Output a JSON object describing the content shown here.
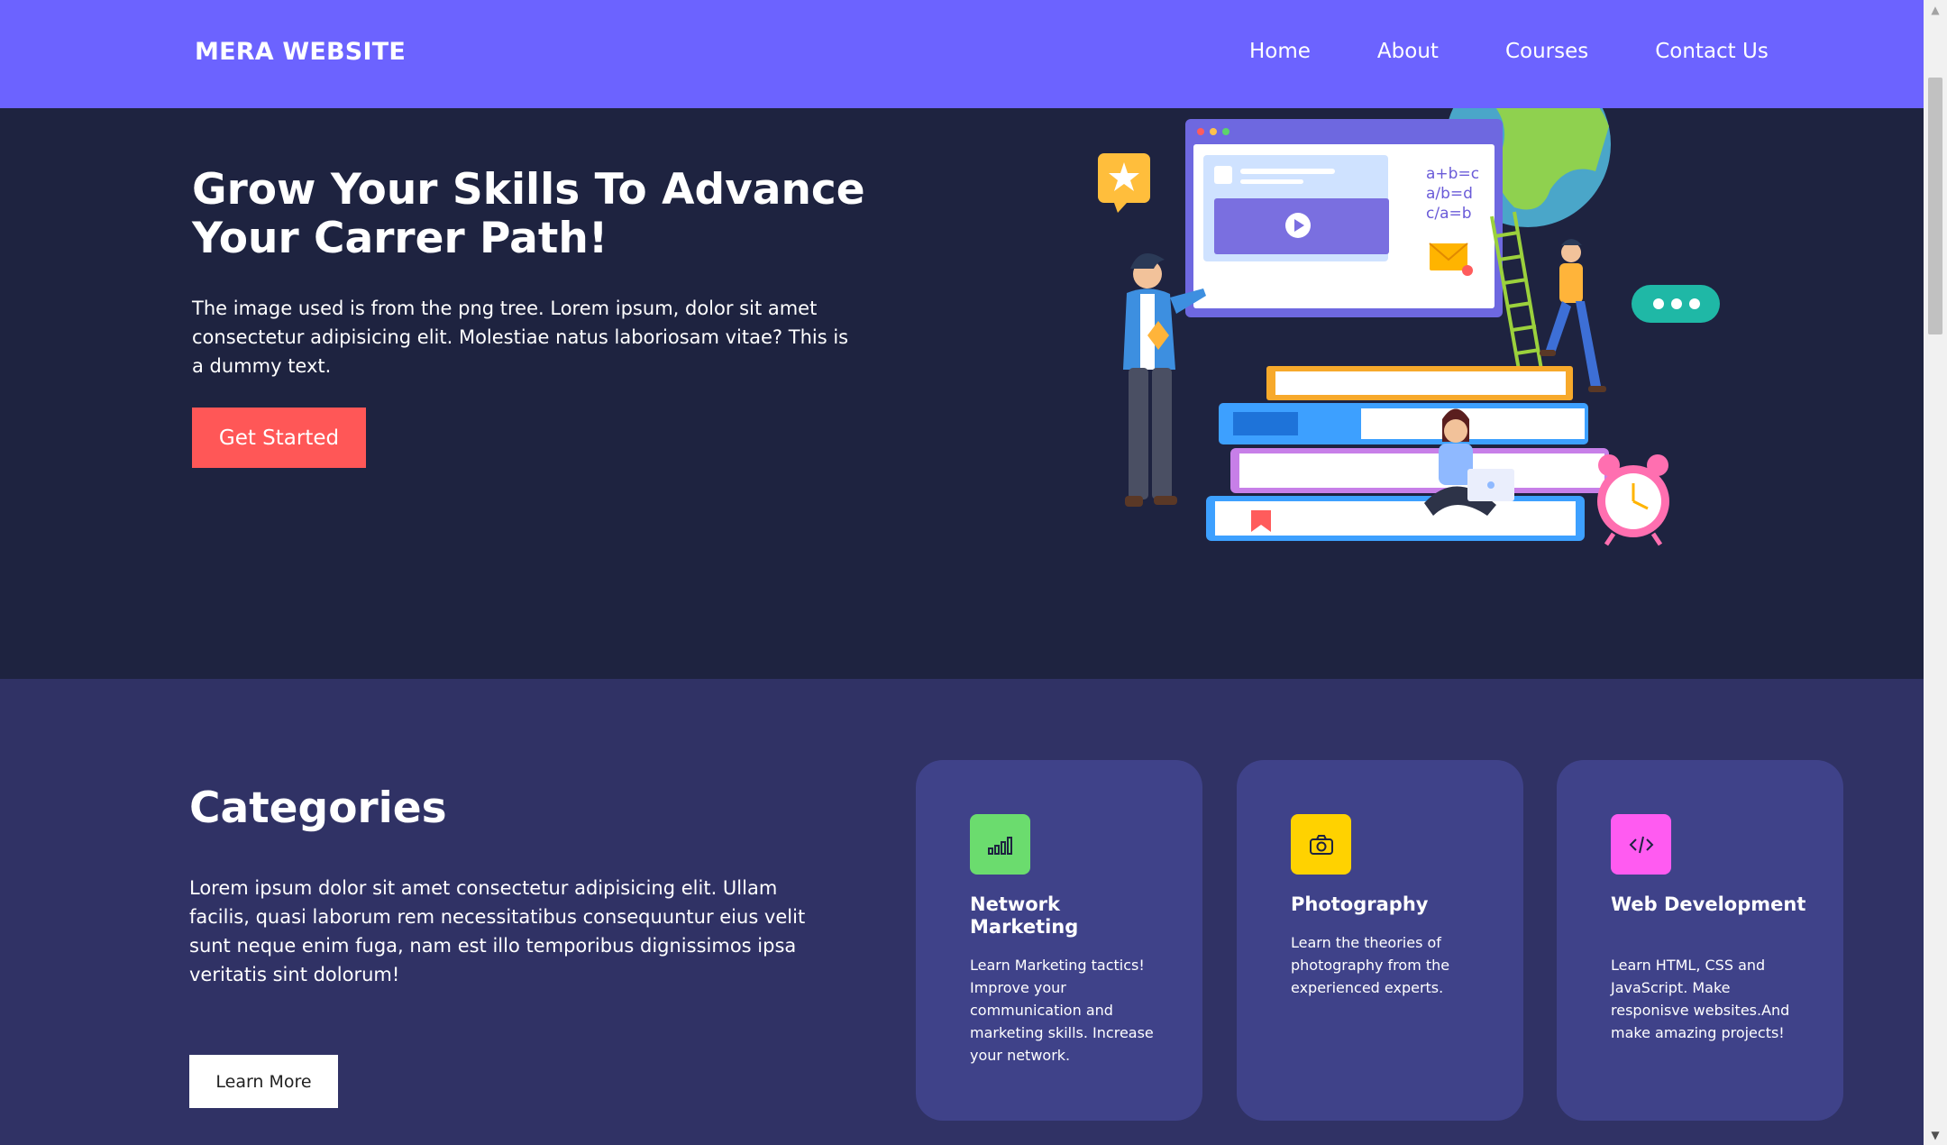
{
  "nav": {
    "brand": "MERA WEBSITE",
    "links": [
      "Home",
      "About",
      "Courses",
      "Contact Us"
    ]
  },
  "hero": {
    "title": "Grow Your Skills To Advance Your Carrer Path!",
    "text": "The image used is from the png tree. Lorem ipsum, dolor sit amet consectetur adipisicing elit. Molestiae natus laboriosam vitae? This is a dummy text.",
    "button": "Get Started",
    "illustration_text": [
      "a+b=c",
      "a/b=d",
      "c/a=b"
    ]
  },
  "categories": {
    "title": "Categories",
    "text": "Lorem ipsum dolor sit amet consectetur adipisicing elit. Ullam facilis, quasi laborum rem necessitatibus consequuntur eius velit sunt neque enim fuga, nam est illo temporibus dignissimos ipsa veritatis sint dolorum!",
    "button": "Learn More",
    "cards": [
      {
        "title": "Network Marketing",
        "desc": "Learn Marketing tactics! Improve your communication and marketing skills. Increase your network.",
        "icon": "signal-bars-icon",
        "color": "#6bdc6e"
      },
      {
        "title": "Photography",
        "desc": "Learn the theories of photography from the experienced experts.",
        "icon": "camera-icon",
        "color": "#ffd200"
      },
      {
        "title": "Web Development",
        "desc": "Learn HTML, CSS and JavaScript. Make responisve websites.And make amazing projects!",
        "icon": "code-icon",
        "color": "#ff5bf1"
      }
    ]
  },
  "colors": {
    "nav": "#6c63ff",
    "hero_bg": "#1e2340",
    "categories_bg": "#303265",
    "card_bg": "#3f4289",
    "cta": "#ff5757"
  }
}
